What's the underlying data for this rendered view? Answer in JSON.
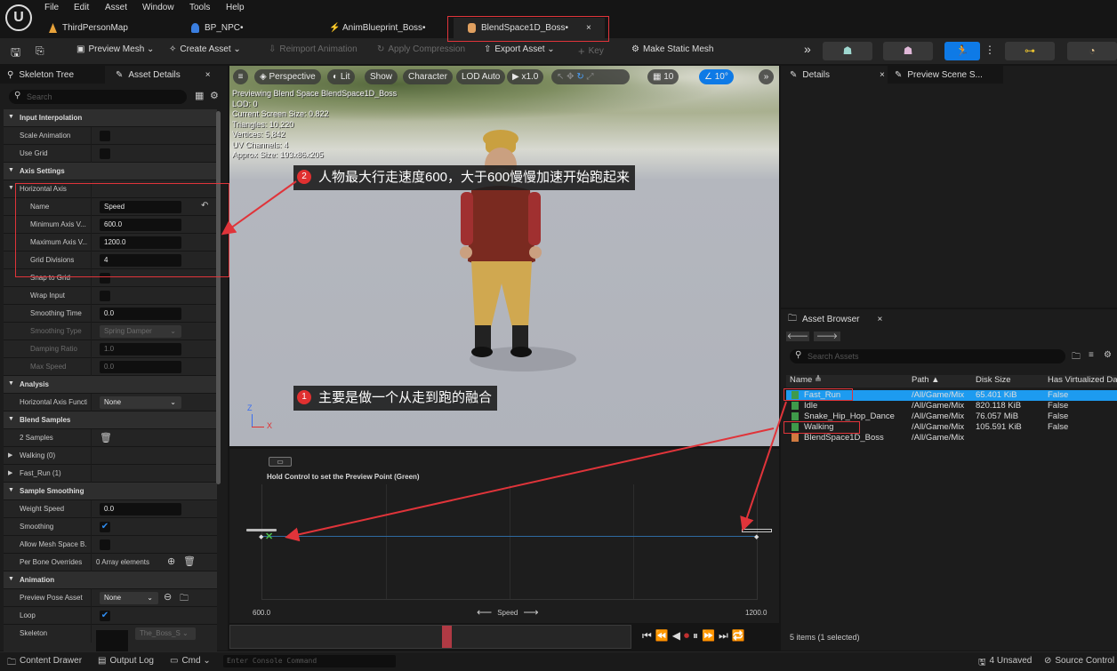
{
  "menu": [
    "File",
    "Edit",
    "Asset",
    "Window",
    "Tools",
    "Help"
  ],
  "logo": "U",
  "tabs": [
    {
      "label": "ThirdPersonMap"
    },
    {
      "label": "BP_NPC•"
    },
    {
      "label": "AnimBlueprint_Boss•"
    },
    {
      "label": "BlendSpace1D_Boss•",
      "close": "×"
    }
  ],
  "toolbar": {
    "preview_mesh": "Preview Mesh ⌄",
    "create_asset": "Create Asset ⌄",
    "reimport": "Reimport Animation",
    "apply_compression": "Apply Compression",
    "export_asset": "Export Asset ⌄",
    "key": "Key",
    "make_static_mesh": "Make Static Mesh",
    "more": "»"
  },
  "left_tabs": {
    "skeleton_tree": "Skeleton Tree",
    "asset_details": "Asset Details",
    "close": "×"
  },
  "search_placeholder": "Search",
  "properties": [
    {
      "kind": "hdr",
      "label": "Input Interpolation"
    },
    {
      "kind": "check",
      "label": "Scale Animation",
      "checked": false
    },
    {
      "kind": "check",
      "label": "Use Grid",
      "checked": false
    },
    {
      "kind": "hdr",
      "label": "Axis Settings"
    },
    {
      "kind": "sub",
      "label": "Horizontal Axis"
    },
    {
      "kind": "text",
      "label": "Name",
      "value": "Speed",
      "reset": true,
      "indent": 2
    },
    {
      "kind": "text",
      "label": "Minimum Axis V...",
      "value": "600.0",
      "indent": 2
    },
    {
      "kind": "text",
      "label": "Maximum Axis V...",
      "value": "1200.0",
      "indent": 2
    },
    {
      "kind": "text",
      "label": "Grid Divisions",
      "value": "4",
      "indent": 2
    },
    {
      "kind": "check",
      "label": "Snap to Grid",
      "checked": false,
      "indent": 2
    },
    {
      "kind": "check",
      "label": "Wrap Input",
      "checked": false,
      "indent": 2
    },
    {
      "kind": "text",
      "label": "Smoothing Time",
      "value": "0.0",
      "indent": 2
    },
    {
      "kind": "dd",
      "label": "Smoothing Type",
      "value": "Spring Damper",
      "indent": 2,
      "disabled": true
    },
    {
      "kind": "text",
      "label": "Damping Ratio",
      "value": "1.0",
      "indent": 2,
      "disabled": true
    },
    {
      "kind": "text",
      "label": "Max Speed",
      "value": "0.0",
      "indent": 2,
      "disabled": true
    },
    {
      "kind": "hdr",
      "label": "Analysis"
    },
    {
      "kind": "dd",
      "label": "Horizontal Axis Functi",
      "value": "None"
    },
    {
      "kind": "hdr",
      "label": "Blend Samples"
    },
    {
      "kind": "trash",
      "label": "2 Samples"
    },
    {
      "kind": "exp",
      "label": "Walking (0)"
    },
    {
      "kind": "exp",
      "label": "Fast_Run (1)"
    },
    {
      "kind": "hdr",
      "label": "Sample Smoothing"
    },
    {
      "kind": "text",
      "label": "Weight Speed",
      "value": "0.0"
    },
    {
      "kind": "check",
      "label": "Smoothing",
      "checked": true
    },
    {
      "kind": "check",
      "label": "Allow Mesh Space B...",
      "checked": false
    },
    {
      "kind": "array",
      "label": "Per Bone Overrides",
      "value": "0 Array elements"
    },
    {
      "kind": "hdr",
      "label": "Animation"
    },
    {
      "kind": "dd",
      "label": "Preview Pose Asset",
      "value": "None",
      "short": true
    },
    {
      "kind": "check",
      "label": "Loop",
      "checked": true
    },
    {
      "kind": "skel",
      "label": "Skeleton",
      "value": "The_Boss_S ⌄"
    }
  ],
  "viewport": {
    "buttons": [
      "Perspective",
      "Lit",
      "Show",
      "Character",
      "LOD Auto",
      "▶ x1.0",
      "10",
      "10°"
    ],
    "stats": [
      "Previewing Blend Space BlendSpace1D_Boss",
      "LOD: 0",
      "Current Screen Size: 0.822",
      "Triangles: 10,220",
      "Vertices: 5,842",
      "UV Channels: 4",
      "Approx Size: 193x86x205"
    ],
    "axis_z": "Z",
    "axis_x": "X"
  },
  "annotations": [
    {
      "num": "2",
      "text": "人物最大行走速度600，大于600慢慢加速开始跑起来"
    },
    {
      "num": "1",
      "text": "主要是做一个从走到跑的融合"
    }
  ],
  "blend_editor": {
    "hint": "Hold Control to set the Preview Point (Green)",
    "axis_name": "Speed",
    "min_label": "600.0",
    "max_label": "1200.0",
    "grid_divisions": 4,
    "preview_value": 600
  },
  "timeline": {
    "position": 0.54
  },
  "right_tabs": {
    "details": "Details",
    "preview_scene": "Preview Scene S...",
    "close": "×"
  },
  "asset_browser": {
    "title": "Asset Browser",
    "close": "×",
    "search_placeholder": "Search Assets",
    "columns": [
      "Name ≜",
      "Path ▲",
      "Disk Size",
      "Has Virtualized Da"
    ],
    "rows": [
      {
        "name": "Fast_Run",
        "path": "/All/Game/Mix",
        "size": "65.401 KiB",
        "virt": "False",
        "selected": true
      },
      {
        "name": "Idle",
        "path": "/All/Game/Mix",
        "size": "820.118 KiB",
        "virt": "False"
      },
      {
        "name": "Snake_Hip_Hop_Dance",
        "path": "/All/Game/Mix",
        "size": "76.057 MiB",
        "virt": "False"
      },
      {
        "name": "Walking",
        "path": "/All/Game/Mix",
        "size": "105.591 KiB",
        "virt": "False"
      },
      {
        "name": "BlendSpace1D_Boss",
        "path": "/All/Game/Mix",
        "size": "",
        "virt": "",
        "blendspace": true
      }
    ],
    "count": "5 items (1 selected)"
  },
  "status": {
    "content_drawer": "Content Drawer",
    "output_log": "Output Log",
    "cmd": "Cmd ⌄",
    "console_placeholder": "Enter Console Command",
    "unsaved": "4 Unsaved",
    "source_control": "Source Control"
  },
  "colors": {
    "accent": "#0e7ae6",
    "annotation": "#e0343a",
    "selection": "#1d9bf0"
  }
}
